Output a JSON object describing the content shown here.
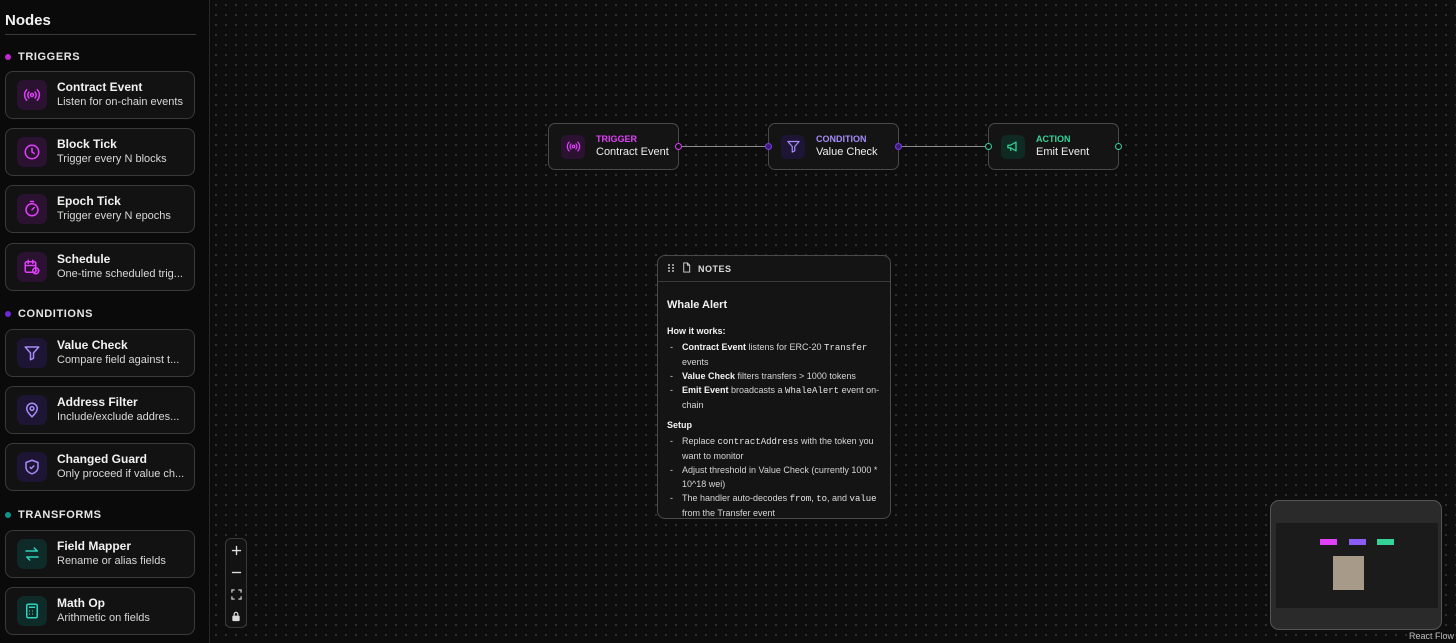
{
  "sidebar": {
    "title": "Nodes",
    "sections": {
      "triggers": {
        "label": "TRIGGERS",
        "color": "#c026d3"
      },
      "conditions": {
        "label": "CONDITIONS",
        "color": "#6d28d9"
      },
      "transforms": {
        "label": "TRANSFORMS",
        "color": "#0d9488"
      }
    },
    "items": [
      {
        "title": "Contract Event",
        "desc": "Listen for on-chain events",
        "icon": "broadcast-icon"
      },
      {
        "title": "Block Tick",
        "desc": "Trigger every N blocks",
        "icon": "clock-icon"
      },
      {
        "title": "Epoch Tick",
        "desc": "Trigger every N epochs",
        "icon": "stopwatch-icon"
      },
      {
        "title": "Schedule",
        "desc": "One-time scheduled trig...",
        "icon": "calendar-clock-icon"
      },
      {
        "title": "Value Check",
        "desc": "Compare field against t...",
        "icon": "funnel-icon"
      },
      {
        "title": "Address Filter",
        "desc": "Include/exclude addres...",
        "icon": "map-pin-icon"
      },
      {
        "title": "Changed Guard",
        "desc": "Only proceed if value ch...",
        "icon": "shield-check-icon"
      },
      {
        "title": "Field Mapper",
        "desc": "Rename or alias fields",
        "icon": "swap-arrows-icon"
      },
      {
        "title": "Math Op",
        "desc": "Arithmetic on fields",
        "icon": "calculator-icon"
      }
    ]
  },
  "canvas": {
    "nodes": [
      {
        "kind": "TRIGGER",
        "name": "Contract Event",
        "color": "#e040fb",
        "icon": "broadcast-icon"
      },
      {
        "kind": "CONDITION",
        "name": "Value Check",
        "color": "#a78bfa",
        "icon": "funnel-icon"
      },
      {
        "kind": "ACTION",
        "name": "Emit Event",
        "color": "#34d399",
        "icon": "megaphone-icon"
      }
    ],
    "notes": {
      "header": "NOTES",
      "title": "Whale Alert",
      "how_title": "How it works:",
      "how": {
        "l1_bold": "Contract Event",
        "l1_a": " listens for ERC-20 ",
        "l1_code": "Transfer",
        "l1_b": " events",
        "l2_bold": "Value Check",
        "l2_a": " filters transfers > 1000 tokens",
        "l3_bold": "Emit Event",
        "l3_a": " broadcasts a ",
        "l3_code": "WhaleAlert",
        "l3_b": " event on-chain"
      },
      "setup_title": "Setup",
      "setup": {
        "s1_a": "Replace ",
        "s1_code": "contractAddress",
        "s1_b": " with the token you want to monitor",
        "s2": "Adjust threshold in Value Check (currently 1000 * 10^18 wei)",
        "s3_a": "The handler auto-decodes ",
        "s3_c1": "from",
        "s3_sep": ", ",
        "s3_c2": "to",
        "s3_and": ", and ",
        "s3_c3": "value",
        "s3_b": " from the Transfer event"
      }
    },
    "attribution": "React Flow"
  }
}
